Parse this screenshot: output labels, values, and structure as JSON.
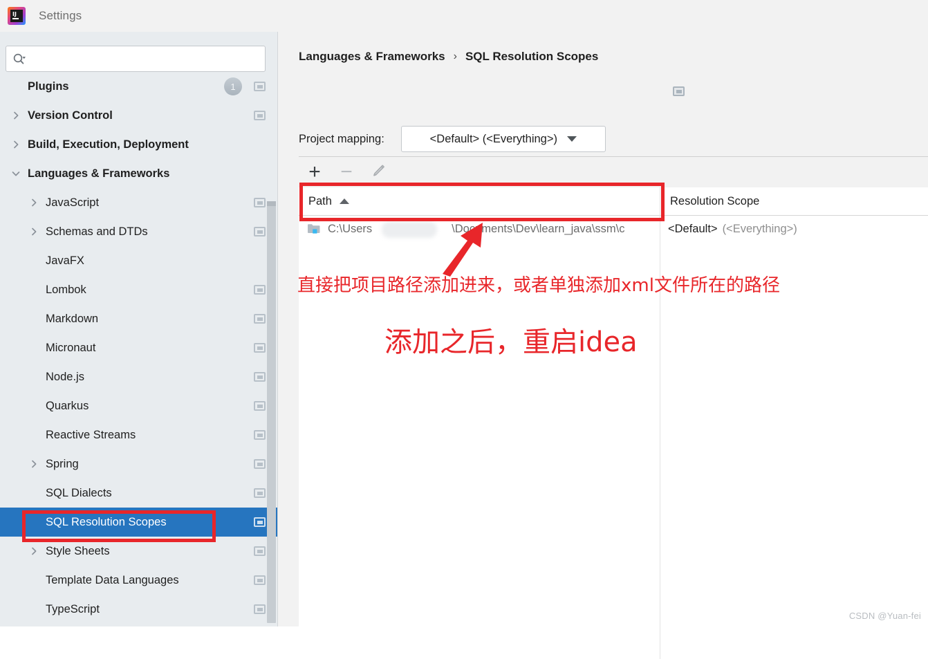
{
  "window": {
    "title": "Settings",
    "logo_icon": "intellij-idea-logo"
  },
  "sidebar": {
    "search": {
      "value": "",
      "placeholder": "",
      "icon": "search-icon"
    },
    "items": [
      {
        "label": "Plugins",
        "bold": true,
        "chevron": "none",
        "badge": "1",
        "config_icon": true,
        "selected": false
      },
      {
        "label": "Version Control",
        "bold": true,
        "chevron": "right",
        "badge": null,
        "config_icon": true,
        "selected": false
      },
      {
        "label": "Build, Execution, Deployment",
        "bold": true,
        "chevron": "right",
        "badge": null,
        "config_icon": false,
        "selected": false
      },
      {
        "label": "Languages & Frameworks",
        "bold": true,
        "chevron": "down",
        "badge": null,
        "config_icon": false,
        "selected": false
      },
      {
        "label": "JavaScript",
        "bold": false,
        "chevron": "right",
        "badge": null,
        "config_icon": true,
        "selected": false
      },
      {
        "label": "Schemas and DTDs",
        "bold": false,
        "chevron": "right",
        "badge": null,
        "config_icon": true,
        "selected": false
      },
      {
        "label": "JavaFX",
        "bold": false,
        "chevron": "none",
        "badge": null,
        "config_icon": false,
        "selected": false
      },
      {
        "label": "Lombok",
        "bold": false,
        "chevron": "none",
        "badge": null,
        "config_icon": true,
        "selected": false
      },
      {
        "label": "Markdown",
        "bold": false,
        "chevron": "none",
        "badge": null,
        "config_icon": true,
        "selected": false
      },
      {
        "label": "Micronaut",
        "bold": false,
        "chevron": "none",
        "badge": null,
        "config_icon": true,
        "selected": false
      },
      {
        "label": "Node.js",
        "bold": false,
        "chevron": "none",
        "badge": null,
        "config_icon": true,
        "selected": false
      },
      {
        "label": "Quarkus",
        "bold": false,
        "chevron": "none",
        "badge": null,
        "config_icon": true,
        "selected": false
      },
      {
        "label": "Reactive Streams",
        "bold": false,
        "chevron": "none",
        "badge": null,
        "config_icon": true,
        "selected": false
      },
      {
        "label": "Spring",
        "bold": false,
        "chevron": "right",
        "badge": null,
        "config_icon": true,
        "selected": false
      },
      {
        "label": "SQL Dialects",
        "bold": false,
        "chevron": "none",
        "badge": null,
        "config_icon": true,
        "selected": false
      },
      {
        "label": "SQL Resolution Scopes",
        "bold": false,
        "chevron": "none",
        "badge": null,
        "config_icon": true,
        "selected": true
      },
      {
        "label": "Style Sheets",
        "bold": false,
        "chevron": "right",
        "badge": null,
        "config_icon": true,
        "selected": false
      },
      {
        "label": "Template Data Languages",
        "bold": false,
        "chevron": "none",
        "badge": null,
        "config_icon": true,
        "selected": false
      },
      {
        "label": "TypeScript",
        "bold": false,
        "chevron": "none",
        "badge": null,
        "config_icon": true,
        "selected": false
      }
    ]
  },
  "main": {
    "breadcrumb": {
      "parent": "Languages & Frameworks",
      "separator": "›",
      "current": "SQL Resolution Scopes"
    },
    "project_mapping": {
      "label": "Project mapping:",
      "value": "<Default> (<Everything>)"
    },
    "toolbar": {
      "add_label": "+",
      "remove_label": "−",
      "edit_icon": "pencil-icon"
    },
    "table": {
      "columns": [
        {
          "key": "path",
          "header": "Path",
          "sorted": "asc"
        },
        {
          "key": "scope",
          "header": "Resolution Scope",
          "sorted": null
        }
      ],
      "rows": [
        {
          "icon": "folder-icon",
          "path_prefix": "C:\\Users",
          "path_redacted": true,
          "path_suffix": "\\Documents\\Dev\\learn_java\\ssm\\c",
          "scope_primary": "<Default>",
          "scope_secondary": "(<Everything>)"
        }
      ]
    }
  },
  "annotations": {
    "color": "#e8262a",
    "text_line1": "直接把项目路径添加进来，或者单独添加xml文件所在的路径",
    "text_line2": "添加之后，重启idea",
    "arrow_icon": "arrow-up-right-icon"
  },
  "watermark": {
    "text": "CSDN @Yuan-fei"
  }
}
